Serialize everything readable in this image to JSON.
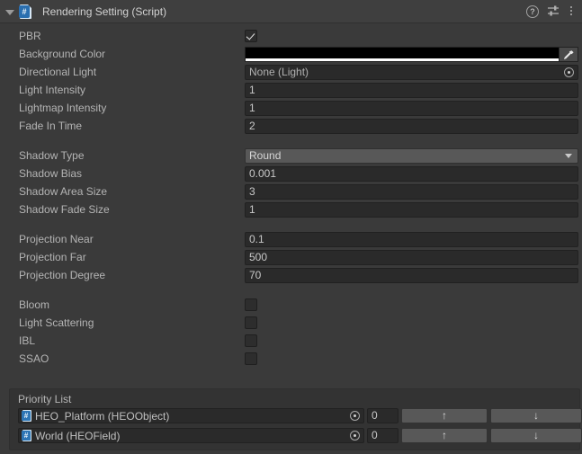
{
  "header": {
    "title": "Rendering Setting (Script)",
    "foldout_icon": "triangle-down-icon",
    "component_icon": "csharp-script-icon",
    "component_icon_glyph": "#",
    "help_icon": "help-icon",
    "help_glyph": "?",
    "preset_icon": "preset-sliders-icon",
    "menu_icon": "kebab-menu-icon"
  },
  "colors": {
    "panel_bg": "#3a3a3a",
    "header_bg": "#3f3f3f",
    "field_bg": "#2a2a2a",
    "button_bg": "#585858",
    "label_text": "#b4b4b4",
    "value_text": "#c8c8c8",
    "background_color_value": "#000000",
    "background_color_alpha_bar": "#ffffff"
  },
  "groups": [
    {
      "name": "general",
      "rows": [
        {
          "label": "PBR",
          "type": "checkbox",
          "checked": true,
          "name": "pbr"
        },
        {
          "label": "Background Color",
          "type": "color",
          "value": "#000000",
          "alpha_bar": "#ffffff",
          "name": "background-color"
        },
        {
          "label": "Directional Light",
          "type": "object",
          "value": "None (Light)",
          "name": "directional-light"
        },
        {
          "label": "Light Intensity",
          "type": "number",
          "value": "1",
          "name": "light-intensity"
        },
        {
          "label": "Lightmap Intensity",
          "type": "number",
          "value": "1",
          "name": "lightmap-intensity"
        },
        {
          "label": "Fade In Time",
          "type": "number",
          "value": "2",
          "name": "fade-in-time"
        }
      ]
    },
    {
      "name": "shadow",
      "rows": [
        {
          "label": "Shadow Type",
          "type": "dropdown",
          "value": "Round",
          "name": "shadow-type"
        },
        {
          "label": "Shadow Bias",
          "type": "number",
          "value": "0.001",
          "name": "shadow-bias"
        },
        {
          "label": "Shadow Area Size",
          "type": "number",
          "value": "3",
          "name": "shadow-area-size"
        },
        {
          "label": "Shadow Fade Size",
          "type": "number",
          "value": "1",
          "name": "shadow-fade-size"
        }
      ]
    },
    {
      "name": "projection",
      "rows": [
        {
          "label": "Projection Near",
          "type": "number",
          "value": "0.1",
          "name": "projection-near"
        },
        {
          "label": "Projection Far",
          "type": "number",
          "value": "500",
          "name": "projection-far"
        },
        {
          "label": "Projection Degree",
          "type": "number",
          "value": "70",
          "name": "projection-degree"
        }
      ]
    },
    {
      "name": "effects",
      "rows": [
        {
          "label": "Bloom",
          "type": "checkbox",
          "checked": false,
          "name": "bloom"
        },
        {
          "label": "Light Scattering",
          "type": "checkbox",
          "checked": false,
          "name": "light-scattering"
        },
        {
          "label": "IBL",
          "type": "checkbox",
          "checked": false,
          "name": "ibl"
        },
        {
          "label": "SSAO",
          "type": "checkbox",
          "checked": false,
          "name": "ssao"
        }
      ]
    }
  ],
  "priority_list": {
    "title": "Priority List",
    "up_label": "↑",
    "down_label": "↓",
    "icon": "csharp-script-icon",
    "icon_glyph": "#",
    "items": [
      {
        "object": "HEO_Platform (HEOObject)",
        "value": "0"
      },
      {
        "object": "World (HEOField)",
        "value": "0"
      }
    ]
  }
}
